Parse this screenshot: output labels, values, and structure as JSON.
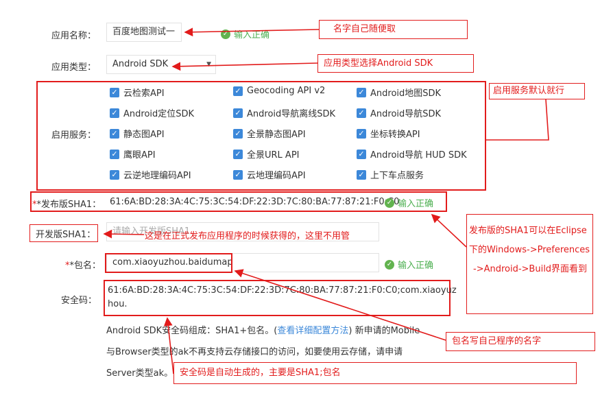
{
  "form": {
    "app_name": {
      "label": "应用名称：",
      "value": "百度地图测试一"
    },
    "app_type": {
      "label": "应用类型：",
      "value": "Android SDK"
    },
    "services_label": "启用服务：",
    "services": [
      [
        "云检索API",
        "Geocoding API v2",
        "Android地图SDK"
      ],
      [
        "Android定位SDK",
        "Android导航离线SDK",
        "Android导航SDK"
      ],
      [
        "静态图API",
        "全景静态图API",
        "坐标转换API"
      ],
      [
        "鹰眼API",
        "全景URL API",
        "Android导航 HUD SDK"
      ],
      [
        "云逆地理编码API",
        "云地理编码API",
        "上下车点服务"
      ]
    ],
    "release_sha1": {
      "label": "*发布版SHA1：",
      "value": "61:6A:BD:28:3A:4C:75:3C:54:DF:22:3D:7C:80:BA:77:87:21:F0:C0"
    },
    "dev_sha1": {
      "label": "开发版SHA1：",
      "placeholder": "请输入开发版SHA1"
    },
    "package": {
      "label": "*包名：",
      "value": "com.xiaoyuzhou.baidumap"
    },
    "security_code": {
      "label": "安全码：",
      "line1": "61:6A:BD:28:3A:4C:75:3C:54:DF:22:3D:7C:80:BA:77:87:21:F0:C0;com.xiaoyuz",
      "line2": "hou."
    },
    "valid_text": "输入正确",
    "desc": {
      "line1_a": "Android SDK安全码组成：SHA1+包名。(",
      "link": "查看详细配置方法",
      "line1_b": ") 新申请的Mobile",
      "line2": "与Browser类型的ak不再支持云存储接口的访问，如要使用云存储，请申请",
      "line3": "Server类型ak。"
    }
  },
  "annotations": {
    "name": "名字自己随便取",
    "type": "应用类型选择Android SDK",
    "services": "启用服务默认就行",
    "dev_sha1": "这是在正式发布应用程序的时候获得的，这里不用管",
    "sha1_l1": "发布版的SHA1可以在Eclipse",
    "sha1_l2": "下的Windows->Preferences",
    "sha1_l3": "->Android->Build界面看到",
    "package": "包名写自己程序的名字",
    "security": "安全码是自动生成的，主要是SHA1;包名"
  },
  "colors": {
    "accent_red": "#e21b1b",
    "ok_green": "#4caf50",
    "checkbox_blue": "#3c88d9"
  }
}
